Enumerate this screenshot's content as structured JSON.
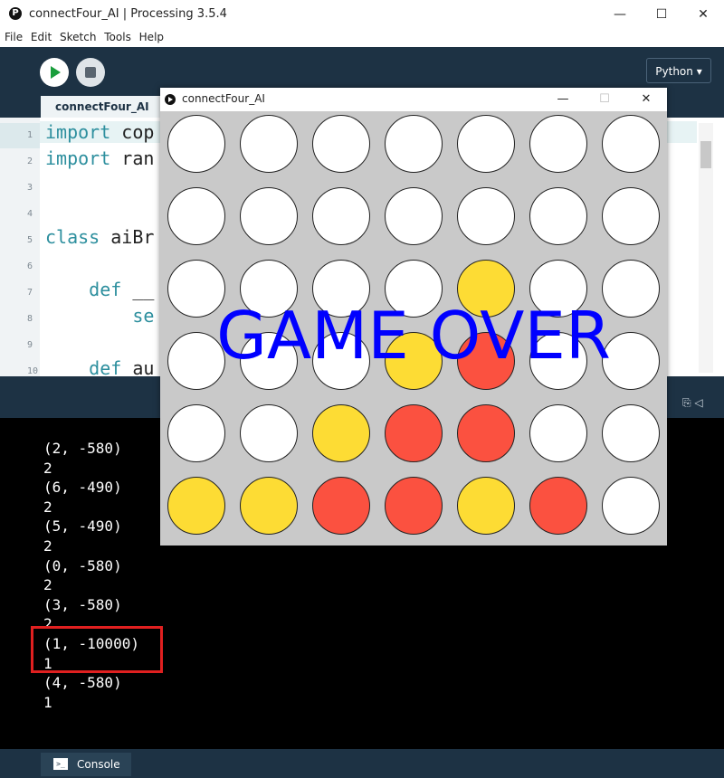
{
  "window": {
    "title": "connectFour_AI | Processing 3.5.4",
    "app_icon": "P",
    "min_glyph": "—",
    "max_glyph": "☐",
    "close_glyph": "✕"
  },
  "menu": [
    "File",
    "Edit",
    "Sketch",
    "Tools",
    "Help"
  ],
  "toolbar": {
    "mode_label": "Python ▾"
  },
  "editor": {
    "tab_label": "connectFour_AI",
    "line_numbers": [
      "1",
      "2",
      "3",
      "4",
      "5",
      "6",
      "7",
      "8",
      "9",
      "10"
    ],
    "lines": [
      {
        "kw": "import",
        "rest": " cop"
      },
      {
        "kw": "import",
        "rest": " ran"
      },
      {
        "kw": "",
        "rest": ""
      },
      {
        "kw": "",
        "rest": ""
      },
      {
        "kw": "class",
        "rest": " aiBr"
      },
      {
        "kw": "",
        "rest": ""
      },
      {
        "kw": "    def",
        "rest": " __"
      },
      {
        "kw": "",
        "rest": "        se"
      },
      {
        "kw": "",
        "rest": ""
      },
      {
        "kw": "    def",
        "rest": " au"
      }
    ]
  },
  "console": {
    "lines": [
      "(2, -580)",
      "2",
      "(6, -490)",
      "2",
      "(5, -490)",
      "2",
      "(0, -580)",
      "2",
      "(3, -580)",
      "2",
      "(1, -10000)",
      "1",
      "(4, -580)",
      "1"
    ],
    "tab_label": "Console",
    "tab_icon": ">_",
    "strip_icons": "⎘  ◁"
  },
  "sketch": {
    "title": "connectFour_AI",
    "min_glyph": "—",
    "max_glyph": "☐",
    "close_glyph": "✕",
    "overlay_text": "GAME OVER",
    "colors": {
      "empty": "#ffffff",
      "yellow": "#fddc34",
      "red": "#fb5140",
      "overlay": "#0000ff"
    },
    "board": [
      [
        "empty",
        "empty",
        "empty",
        "empty",
        "empty",
        "empty",
        "empty"
      ],
      [
        "empty",
        "empty",
        "empty",
        "empty",
        "empty",
        "empty",
        "empty"
      ],
      [
        "empty",
        "empty",
        "empty",
        "empty",
        "yellow",
        "empty",
        "empty"
      ],
      [
        "empty",
        "empty",
        "empty",
        "yellow",
        "red",
        "empty",
        "empty"
      ],
      [
        "empty",
        "empty",
        "yellow",
        "red",
        "red",
        "empty",
        "empty"
      ],
      [
        "yellow",
        "yellow",
        "red",
        "red",
        "yellow",
        "red",
        "empty"
      ]
    ]
  }
}
